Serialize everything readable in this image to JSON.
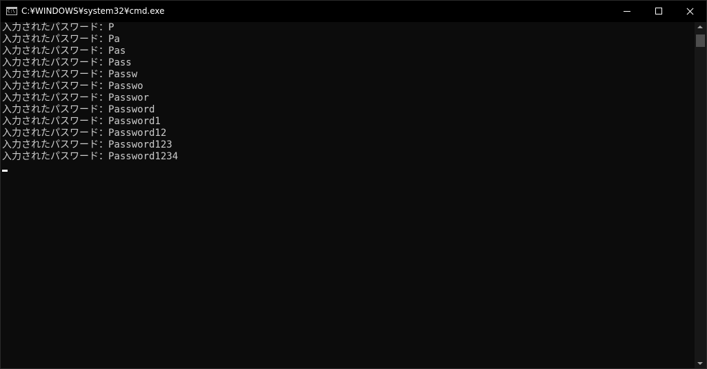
{
  "window": {
    "title": "C:¥WINDOWS¥system32¥cmd.exe",
    "icon": "cmd-icon",
    "icon_glyph": "C:\\",
    "controls": {
      "minimize": "minimize-icon",
      "maximize": "maximize-icon",
      "close": "close-icon"
    }
  },
  "console": {
    "lines": [
      "入力されたパスワード：P",
      "入力されたパスワード：Pa",
      "入力されたパスワード：Pas",
      "入力されたパスワード：Pass",
      "入力されたパスワード：Passw",
      "入力されたパスワード：Passwo",
      "入力されたパスワード：Passwor",
      "入力されたパスワード：Password",
      "入力されたパスワード：Password1",
      "入力されたパスワード：Password12",
      "入力されたパスワード：Password123",
      "入力されたパスワード：Password1234"
    ]
  },
  "colors": {
    "background": "#0c0c0c",
    "text": "#cccccc",
    "titlebar": "#000000"
  }
}
